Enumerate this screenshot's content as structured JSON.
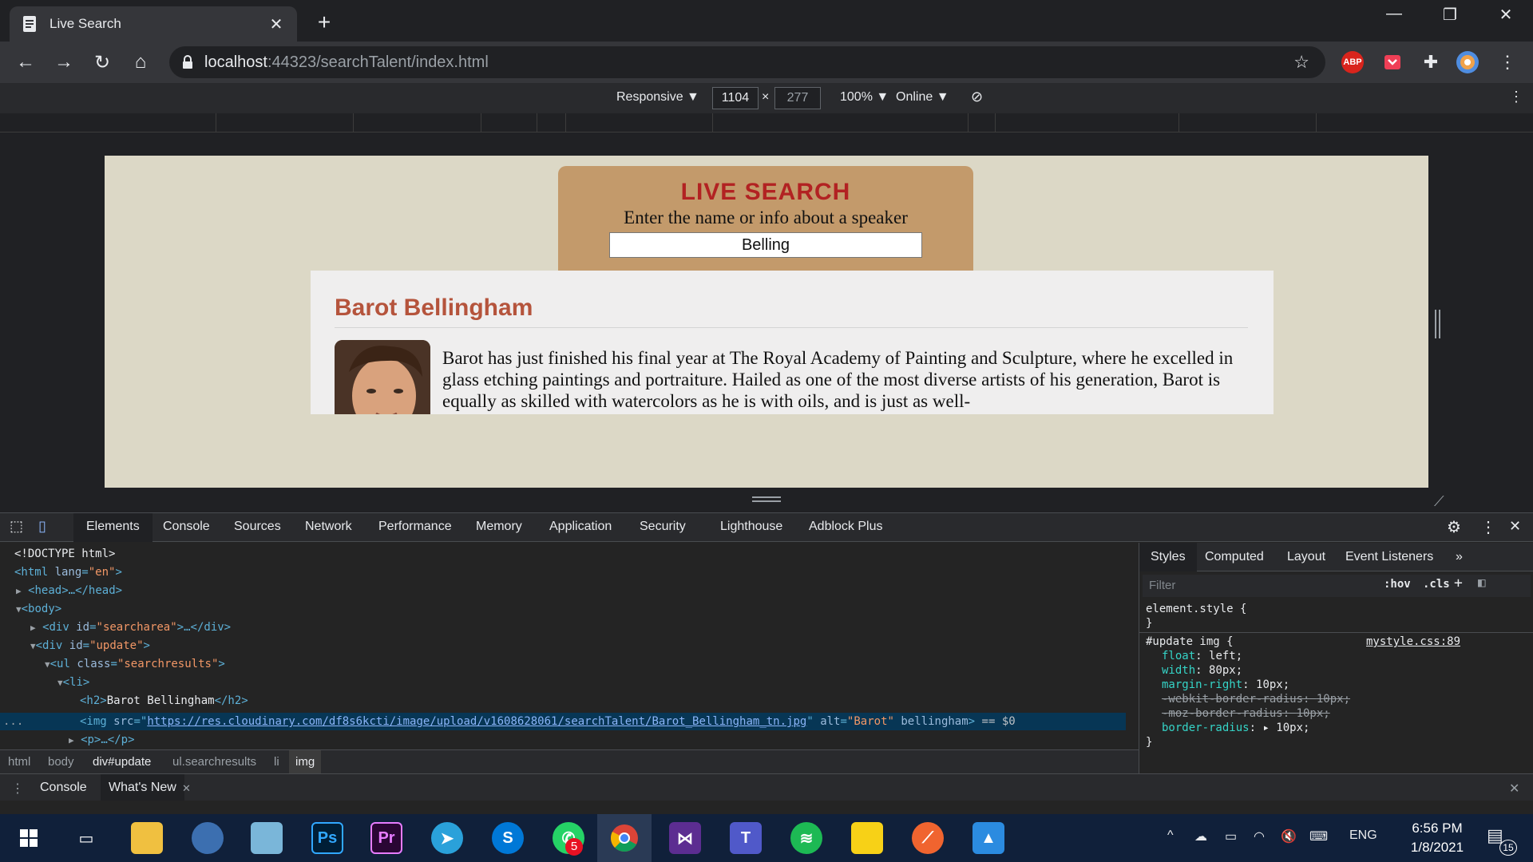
{
  "browser": {
    "tab_title": "Live Search",
    "url_host": "localhost",
    "url_rest": ":44323/searchTalent/index.html",
    "new_tab": "+",
    "close_tab": "✕",
    "extension_abp": "ABP"
  },
  "device_toolbar": {
    "mode": "Responsive ▼",
    "width": "1104",
    "times": "×",
    "height": "277",
    "zoom": "100% ▼",
    "network": "Online ▼"
  },
  "page": {
    "heading": "LIVE SEARCH",
    "subheading": "Enter the name or info about a speaker",
    "search_value": "Belling",
    "result_name": "Barot Bellingham",
    "result_bio": "Barot has just finished his final year at The Royal Academy of Painting and Sculpture, where he excelled in glass etching paintings and portraiture. Hailed as one of the most diverse artists of his generation, Barot is equally as skilled with watercolors as he is with oils, and is just as well-"
  },
  "devtools": {
    "tabs": [
      "Elements",
      "Console",
      "Sources",
      "Network",
      "Performance",
      "Memory",
      "Application",
      "Security",
      "Lighthouse",
      "Adblock Plus"
    ],
    "dom": {
      "doctype": "<!DOCTYPE html>",
      "html_tag": "<html ",
      "html_attr": "lang",
      "html_val": "\"en\"",
      "head": "<head>…</head>",
      "body": "<body>",
      "div1_open": "<div ",
      "div1_attr": "id",
      "div1_val": "\"searcharea\"",
      "div1_close": ">…</div>",
      "div2_val": "\"update\"",
      "ul_attr": "class",
      "ul_val": "\"searchresults\"",
      "li": "<li>",
      "h2_open": "<h2>",
      "h2_text": "Barot Bellingham",
      "h2_close": "</h2>",
      "img_open": "<img ",
      "img_src_attr": "src",
      "img_src": "https://res.cloudinary.com/df8s6kcti/image/upload/v1608628061/searchTalent/Barot_Bellingham_tn.jpg",
      "img_alt_attr": "alt",
      "img_alt": "\"Barot\"",
      "img_rest": " bellingham",
      "img_end": ">",
      "img_eq": "== $0",
      "p": "<p>…</p>",
      "ellipsis": "..."
    },
    "breadcrumbs": [
      "html",
      "body",
      "div#update",
      "ul.searchresults",
      "li",
      "img"
    ],
    "styles_tabs": [
      "Styles",
      "Computed",
      "Layout",
      "Event Listeners",
      "»"
    ],
    "filter_placeholder": "Filter",
    "hov": ":hov",
    "cls": ".cls",
    "rules": {
      "element_style": "element.style {",
      "close": "}",
      "selector": "#update img {",
      "source": "mystyle.css:89",
      "props": [
        {
          "name": "float",
          "value": "left;"
        },
        {
          "name": "width",
          "value": "80px;"
        },
        {
          "name": "margin-right",
          "value": "10px;"
        },
        {
          "name": "-webkit-border-radius",
          "value": "10px;"
        },
        {
          "name": "-moz-border-radius",
          "value": "10px;"
        },
        {
          "name": "border-radius",
          "value": "▸ 10px;"
        }
      ]
    },
    "drawer_tabs": [
      "Console",
      "What's New"
    ]
  },
  "taskbar": {
    "clock_time": "6:56 PM",
    "clock_date": "1/8/2021",
    "lang": "ENG",
    "notif_count": "15",
    "whatsapp_badge": "5",
    "ps_label": "Ps",
    "pr_label": "Pr"
  }
}
